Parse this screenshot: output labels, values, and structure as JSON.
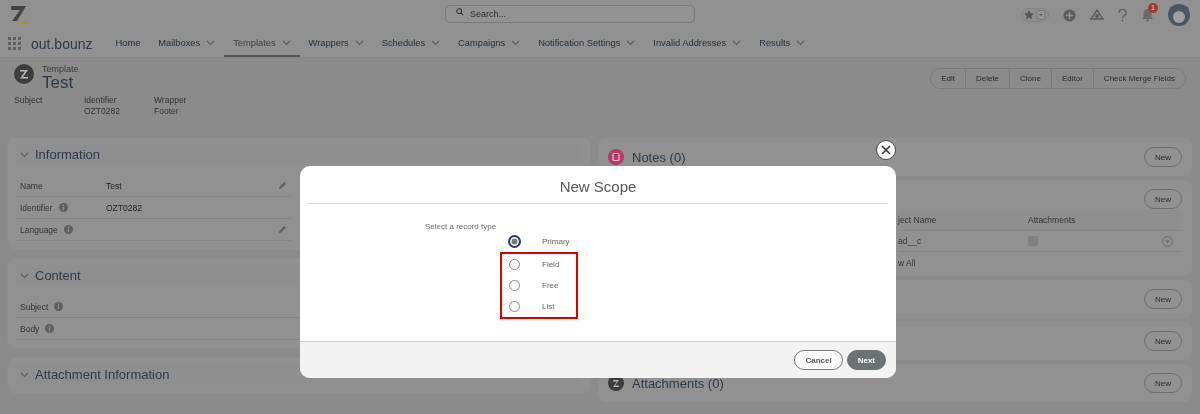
{
  "header": {
    "search": {
      "placeholder": "Search..."
    },
    "notification_count": "1"
  },
  "nav": {
    "app_name": "out.bounz",
    "tabs": [
      {
        "label": "Home",
        "selected": false,
        "dropdown": false
      },
      {
        "label": "Mailboxes",
        "selected": false,
        "dropdown": true
      },
      {
        "label": "Templates",
        "selected": true,
        "dropdown": true
      },
      {
        "label": "Wrappers",
        "selected": false,
        "dropdown": true
      },
      {
        "label": "Schedules",
        "selected": false,
        "dropdown": true
      },
      {
        "label": "Campaigns",
        "selected": false,
        "dropdown": true
      },
      {
        "label": "Notification Settings",
        "selected": false,
        "dropdown": true
      },
      {
        "label": "Invalid Addresses",
        "selected": false,
        "dropdown": true
      },
      {
        "label": "Results",
        "selected": false,
        "dropdown": true
      }
    ]
  },
  "record": {
    "type": "Template",
    "title": "Test",
    "fields": [
      {
        "label": "Subject"
      },
      {
        "label": "Identifier",
        "value": "OZT0282"
      },
      {
        "label": "Wrapper",
        "value": "Footer"
      }
    ],
    "actions": [
      "Edit",
      "Delete",
      "Clone",
      "Editor",
      "Check Merge Fields"
    ]
  },
  "left_sections": [
    {
      "title": "Information",
      "rows": [
        {
          "label": "Name",
          "value": "Test",
          "info": false,
          "editable": true
        },
        {
          "label": "Identifier",
          "value": "OZT0282",
          "info": true,
          "editable": false
        },
        {
          "label": "Language",
          "info": true,
          "editable": true
        }
      ]
    },
    {
      "title": "Content",
      "rows": [
        {
          "label": "Subject",
          "info": true,
          "editable": false
        },
        {
          "label": "Body",
          "info": true,
          "editable": false
        }
      ]
    },
    {
      "title": "Attachment Information"
    }
  ],
  "right_sections": [
    {
      "kind": "notes",
      "title": "Notes (0)",
      "action": "New"
    },
    {
      "kind": "table",
      "action": "New",
      "columns": [
        "ject Name",
        "Attachments"
      ],
      "rows": [
        {
          "cells": [
            "ad__c"
          ],
          "checked": false
        }
      ],
      "footer_link": "w All"
    },
    {
      "kind": "plain",
      "action": "New"
    },
    {
      "kind": "plain",
      "action": "New"
    },
    {
      "kind": "attachments",
      "title": "Attachments (0)",
      "action": "New"
    }
  ],
  "modal": {
    "title": "New Scope",
    "prompt": "Select a record type",
    "options": [
      {
        "label": "Primary",
        "selected": true,
        "highlighted": false
      },
      {
        "label": "Field",
        "selected": false,
        "highlighted": true
      },
      {
        "label": "Free",
        "selected": false,
        "highlighted": true
      },
      {
        "label": "List",
        "selected": false,
        "highlighted": true
      }
    ],
    "buttons": [
      {
        "label": "Cancel",
        "kind": "secondary"
      },
      {
        "label": "Next",
        "kind": "primary"
      }
    ]
  }
}
